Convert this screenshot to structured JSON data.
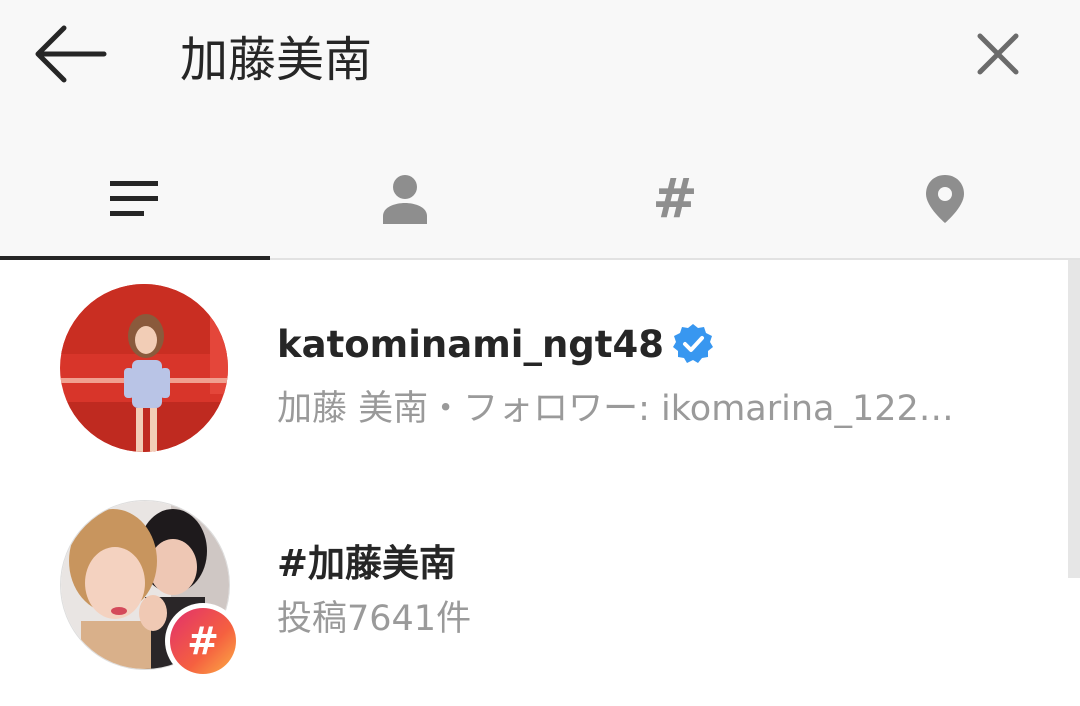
{
  "search": {
    "query": "加藤美南"
  },
  "icons": {
    "back": "arrow-left-icon",
    "clear": "close-icon",
    "tabs": [
      "list-icon",
      "person-icon",
      "hashtag-icon",
      "location-pin-icon"
    ]
  },
  "tabs": {
    "hashtag_glyph": "#",
    "active_index": 0
  },
  "results": [
    {
      "name": "katominami_ngt48",
      "verified": true,
      "subtitle": "加藤 美南・フォロワー: ikomarina_122…"
    },
    {
      "name": "#加藤美南",
      "badge": "#",
      "subtitle": "投稿7641件"
    }
  ],
  "colors": {
    "header_bg": "#f8f8f8",
    "text_primary": "#262626",
    "text_secondary": "#9a9a9a",
    "icon_gray": "#8e8e8e",
    "verified_blue": "#3897f0"
  }
}
